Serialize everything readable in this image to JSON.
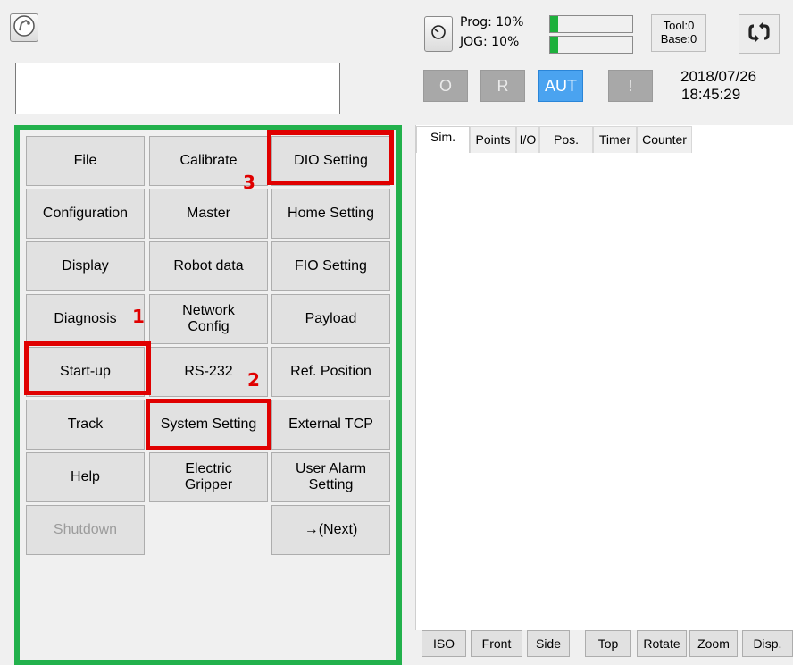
{
  "top_left": {
    "logo_icon": "robot-arm-icon"
  },
  "speed": {
    "prog_label": "Prog: 10%",
    "jog_label": "JOG: 10%",
    "prog_value": 0.1,
    "jog_value": 0.1,
    "bar_color": "#1db03c",
    "gauge_icon": "speedometer-icon"
  },
  "tool_base": {
    "tool": "Tool:0",
    "base": "Base:0"
  },
  "refresh_icon": "refresh-icon",
  "modes": [
    {
      "label": "O",
      "active": false
    },
    {
      "label": "R",
      "active": false
    },
    {
      "label": "AUT",
      "active": true
    },
    {
      "label": "!",
      "active": false
    }
  ],
  "datetime": {
    "date": "2018/07/26",
    "time": "18:45:29"
  },
  "menu": {
    "col1": [
      "File",
      "Configuration",
      "Display",
      "Diagnosis",
      "Start-up",
      "Track",
      "Help",
      "Shutdown"
    ],
    "col2": [
      "Calibrate",
      "Master",
      "Robot data",
      "Network\nConfig",
      "RS-232",
      "System Setting",
      "Electric\nGripper"
    ],
    "col3": [
      "DIO Setting",
      "Home Setting",
      "FIO Setting",
      "Payload",
      "Ref. Position",
      "External TCP",
      "User Alarm\nSetting",
      "→(Next)"
    ]
  },
  "annotations": {
    "step1": "1",
    "step2": "2",
    "step3": "3",
    "highlight_color": "#e00000",
    "panel_color": "#22b14c"
  },
  "tabs": [
    "Sim.",
    "Points",
    "I/O",
    "Pos.",
    "Timer",
    "Counter"
  ],
  "view_buttons": [
    "ISO",
    "Front",
    "Side",
    "Top",
    "Rotate",
    "Zoom",
    "Disp."
  ]
}
